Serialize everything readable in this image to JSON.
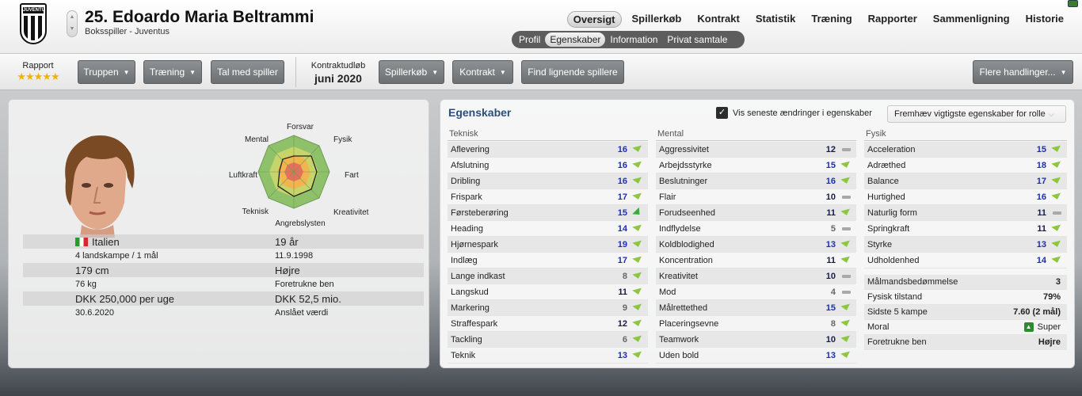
{
  "player": {
    "name": "25. Edoardo Maria Beltrammi",
    "subtitle": "Boksspiller - Juventus",
    "club_crest_text": "JUVENTUS"
  },
  "main_nav": [
    "Oversigt",
    "Spillerkøb",
    "Kontrakt",
    "Statistik",
    "Træning",
    "Rapporter",
    "Sammenligning",
    "Historie"
  ],
  "main_nav_active": "Oversigt",
  "sub_nav": [
    "Profil",
    "Egenskaber",
    "Information",
    "Privat samtale"
  ],
  "sub_nav_active": "Egenskaber",
  "toolbar": {
    "rapport_label": "Rapport",
    "rapport_stars": 5,
    "truppen": "Truppen",
    "traening": "Træning",
    "tal_med": "Tal med spiller",
    "kontrakt_label": "Kontraktudløb",
    "kontrakt_date": "juni 2020",
    "spillerkob": "Spillerkøb",
    "kontrakt": "Kontrakt",
    "find": "Find lignende spillere",
    "flere": "Flere handlinger..."
  },
  "radar": {
    "labels": [
      "Forsvar",
      "Fysik",
      "Fart",
      "Kreativitet",
      "Angrebslysten",
      "Teknisk",
      "Luftkraft",
      "Mental"
    ]
  },
  "bio": {
    "nationality": "Italien",
    "caps": "4 landskampe / 1 mål",
    "age": "19 år",
    "dob": "11.9.1998",
    "height": "179 cm",
    "weight": "76 kg",
    "foot": "Højre",
    "foot_label": "Foretrukne ben",
    "wage": "DKK 250,000 per uge",
    "wage_date": "30.6.2020",
    "value": "DKK 52,5 mio.",
    "value_label": "Anslået værdi"
  },
  "attributes_panel": {
    "title": "Egenskaber",
    "checkbox_label": "Vis seneste ændringer i egenskaber",
    "checkbox_checked": true,
    "highlight_select": "Fremhæv vigtigste egenskaber for rolle"
  },
  "columns": [
    {
      "header": "Teknisk",
      "rows": [
        {
          "name": "Aflevering",
          "value": "16",
          "trend": "up"
        },
        {
          "name": "Afslutning",
          "value": "16",
          "trend": "up"
        },
        {
          "name": "Dribling",
          "value": "16",
          "trend": "up"
        },
        {
          "name": "Frispark",
          "value": "17",
          "trend": "up"
        },
        {
          "name": "Førsteberøring",
          "value": "15",
          "trend": "upg"
        },
        {
          "name": "Heading",
          "value": "14",
          "trend": "up"
        },
        {
          "name": "Hjørnespark",
          "value": "19",
          "trend": "up"
        },
        {
          "name": "Indlæg",
          "value": "17",
          "trend": "up"
        },
        {
          "name": "Lange indkast",
          "value": "8",
          "trend": "up"
        },
        {
          "name": "Langskud",
          "value": "11",
          "trend": "up"
        },
        {
          "name": "Markering",
          "value": "9",
          "trend": "up"
        },
        {
          "name": "Straffespark",
          "value": "12",
          "trend": "up"
        },
        {
          "name": "Tackling",
          "value": "6",
          "trend": "up"
        },
        {
          "name": "Teknik",
          "value": "13",
          "trend": "up"
        }
      ]
    },
    {
      "header": "Mental",
      "rows": [
        {
          "name": "Aggressivitet",
          "value": "12",
          "trend": "flat"
        },
        {
          "name": "Arbejdsstyrke",
          "value": "15",
          "trend": "up"
        },
        {
          "name": "Beslutninger",
          "value": "16",
          "trend": "up"
        },
        {
          "name": "Flair",
          "value": "10",
          "trend": "flat"
        },
        {
          "name": "Forudseenhed",
          "value": "11",
          "trend": "up"
        },
        {
          "name": "Indflydelse",
          "value": "5",
          "trend": "flat"
        },
        {
          "name": "Koldblodighed",
          "value": "13",
          "trend": "up"
        },
        {
          "name": "Koncentration",
          "value": "11",
          "trend": "up"
        },
        {
          "name": "Kreativitet",
          "value": "10",
          "trend": "flat"
        },
        {
          "name": "Mod",
          "value": "4",
          "trend": "flat"
        },
        {
          "name": "Målrettethed",
          "value": "15",
          "trend": "up"
        },
        {
          "name": "Placeringsevne",
          "value": "8",
          "trend": "up"
        },
        {
          "name": "Teamwork",
          "value": "10",
          "trend": "up"
        },
        {
          "name": "Uden bold",
          "value": "13",
          "trend": "up"
        }
      ]
    },
    {
      "header": "Fysik",
      "rows": [
        {
          "name": "Acceleration",
          "value": "15",
          "trend": "up"
        },
        {
          "name": "Adræthed",
          "value": "18",
          "trend": "up"
        },
        {
          "name": "Balance",
          "value": "17",
          "trend": "up"
        },
        {
          "name": "Hurtighed",
          "value": "16",
          "trend": "up"
        },
        {
          "name": "Naturlig form",
          "value": "11",
          "trend": "flat"
        },
        {
          "name": "Springkraft",
          "value": "11",
          "trend": "up"
        },
        {
          "name": "Styrke",
          "value": "13",
          "trend": "up"
        },
        {
          "name": "Udholdenhed",
          "value": "14",
          "trend": "up"
        }
      ],
      "misc": [
        {
          "name": "Målmandsbedømmelse",
          "value": "3"
        },
        {
          "name": "Fysisk tilstand",
          "value": "79%"
        },
        {
          "name": "Sidste 5 kampe",
          "value": "7.60 (2 mål)"
        },
        {
          "name": "Moral",
          "value": "Super"
        },
        {
          "name": "Foretrukne ben",
          "value": "Højre"
        }
      ]
    }
  ]
}
